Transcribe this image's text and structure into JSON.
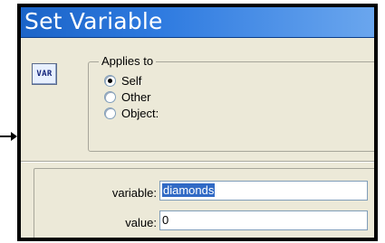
{
  "dialog": {
    "title": "Set Variable",
    "icon_label": "VAR",
    "applies_to": {
      "legend": "Applies to",
      "options": [
        {
          "label": "Self",
          "checked": true
        },
        {
          "label": "Other",
          "checked": false
        },
        {
          "label": "Object:",
          "checked": false
        }
      ]
    },
    "fields": {
      "variable_label": "variable:",
      "variable_value": "diamonds",
      "value_label": "value:",
      "value_value": "0"
    }
  }
}
